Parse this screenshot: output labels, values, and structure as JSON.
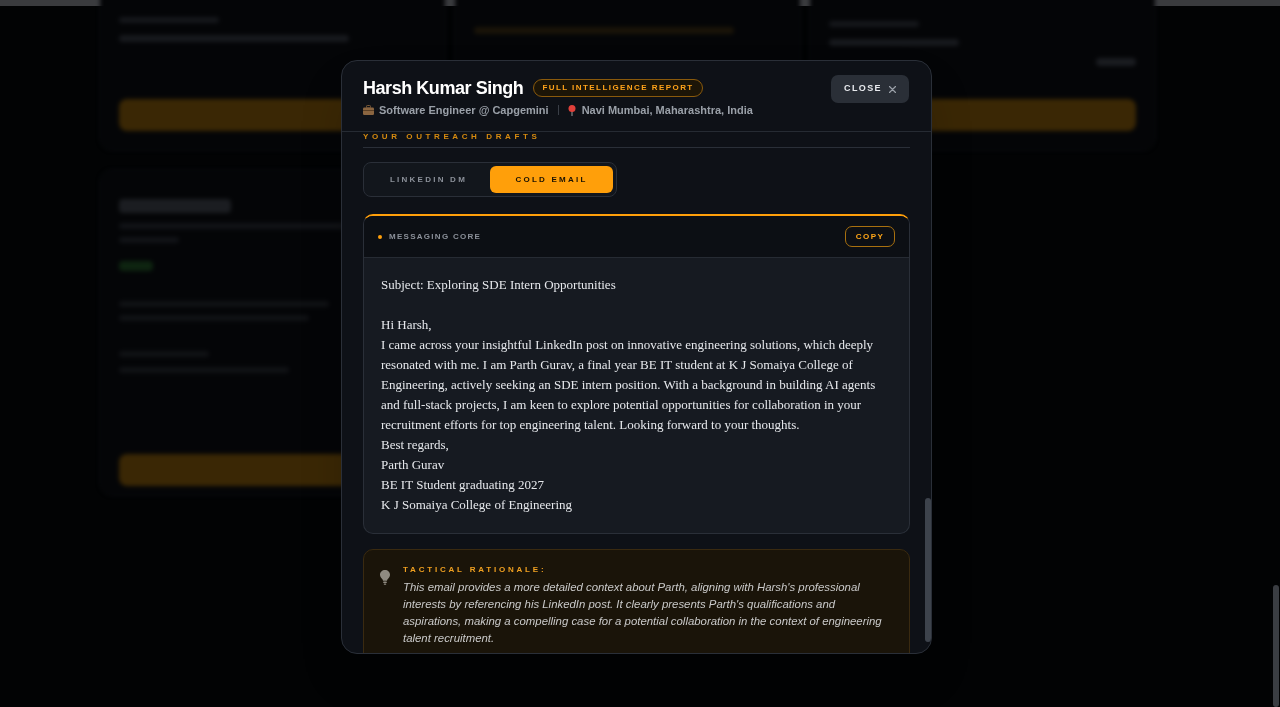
{
  "profile": {
    "name": "Harsh Kumar Singh",
    "badge": "FULL INTELLIGENCE REPORT",
    "role": "Software Engineer @ Capgemini",
    "location": "Navi Mumbai, Maharashtra, India"
  },
  "close_button": {
    "label": "CLOSE"
  },
  "section_title": "YOUR OUTREACH DRAFTS",
  "tabs": [
    {
      "label": "LINKEDIN DM",
      "selected": false
    },
    {
      "label": "COLD EMAIL",
      "selected": true
    }
  ],
  "draft": {
    "header": "MESSAGING CORE",
    "copy_label": "COPY",
    "subject": "Subject: Exploring SDE Intern Opportunities",
    "lines": [
      "Hi Harsh,",
      "I came across your insightful LinkedIn post on innovative engineering solutions, which deeply resonated with me. I am Parth Gurav, a final year BE IT student at K J Somaiya College of Engineering, actively seeking an SDE intern position. With a background in building AI agents and full-stack projects, I am keen to explore potential opportunities for collaboration in your recruitment efforts for top engineering talent. Looking forward to your thoughts.",
      "Best regards,",
      "Parth Gurav",
      "BE IT Student graduating 2027",
      "K J Somaiya College of Engineering"
    ]
  },
  "rationale": {
    "title": "TACTICAL RATIONALE:",
    "text": "This email provides a more detailed context about Parth, aligning with Harsh's professional interests by referencing his LinkedIn post. It clearly presents Parth's qualifications and aspirations, making a compelling case for a potential collaboration in the context of engineering talent recruitment."
  }
}
